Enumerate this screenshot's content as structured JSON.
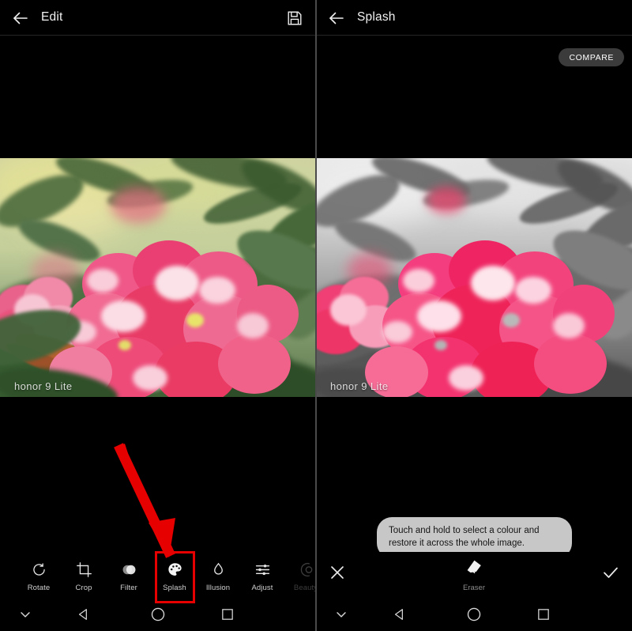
{
  "left_panel": {
    "header": {
      "title": "Edit",
      "back_icon": "back-arrow-icon",
      "save_icon": "save-floppy-icon"
    },
    "photo": {
      "watermark": "honor 9 Lite",
      "description": "colour photo of pink crown-of-thorns flowers with green leaves"
    },
    "toolbar": {
      "items": [
        {
          "label": "Rotate",
          "icon": "rotate-icon"
        },
        {
          "label": "Crop",
          "icon": "crop-icon"
        },
        {
          "label": "Filter",
          "icon": "filter-icon"
        },
        {
          "label": "Splash",
          "icon": "palette-icon"
        },
        {
          "label": "Illusion",
          "icon": "droplet-icon"
        },
        {
          "label": "Adjust",
          "icon": "sliders-icon"
        },
        {
          "label": "Beauty",
          "icon": "beauty-icon"
        }
      ],
      "highlighted_item": "Splash"
    },
    "annotation": {
      "type": "arrow",
      "color": "#e60000",
      "points_to": "Splash"
    }
  },
  "right_panel": {
    "header": {
      "title": "Splash",
      "back_icon": "back-arrow-icon"
    },
    "compare_button": {
      "label": "COMPARE"
    },
    "photo": {
      "watermark": "honor 9 Lite",
      "description": "same photo with greyscale background and pink flowers kept in colour"
    },
    "tooltip": {
      "text": "Touch and hold to select a colour and restore it across the whole image."
    },
    "toolbar": {
      "cancel": {
        "icon": "close-x-icon"
      },
      "tool": {
        "label": "Eraser",
        "icon": "eraser-icon"
      },
      "confirm": {
        "icon": "check-icon"
      }
    }
  },
  "navbar": {
    "buttons": [
      {
        "icon": "chevron-down-icon"
      },
      {
        "icon": "back-triangle-icon"
      },
      {
        "icon": "home-circle-icon"
      },
      {
        "icon": "recents-square-icon"
      }
    ]
  },
  "colors": {
    "accent_red": "#e60000",
    "bg": "#000000",
    "tooltip_bg": "#c7c7c7",
    "compare_bg": "#3b3b3b"
  }
}
